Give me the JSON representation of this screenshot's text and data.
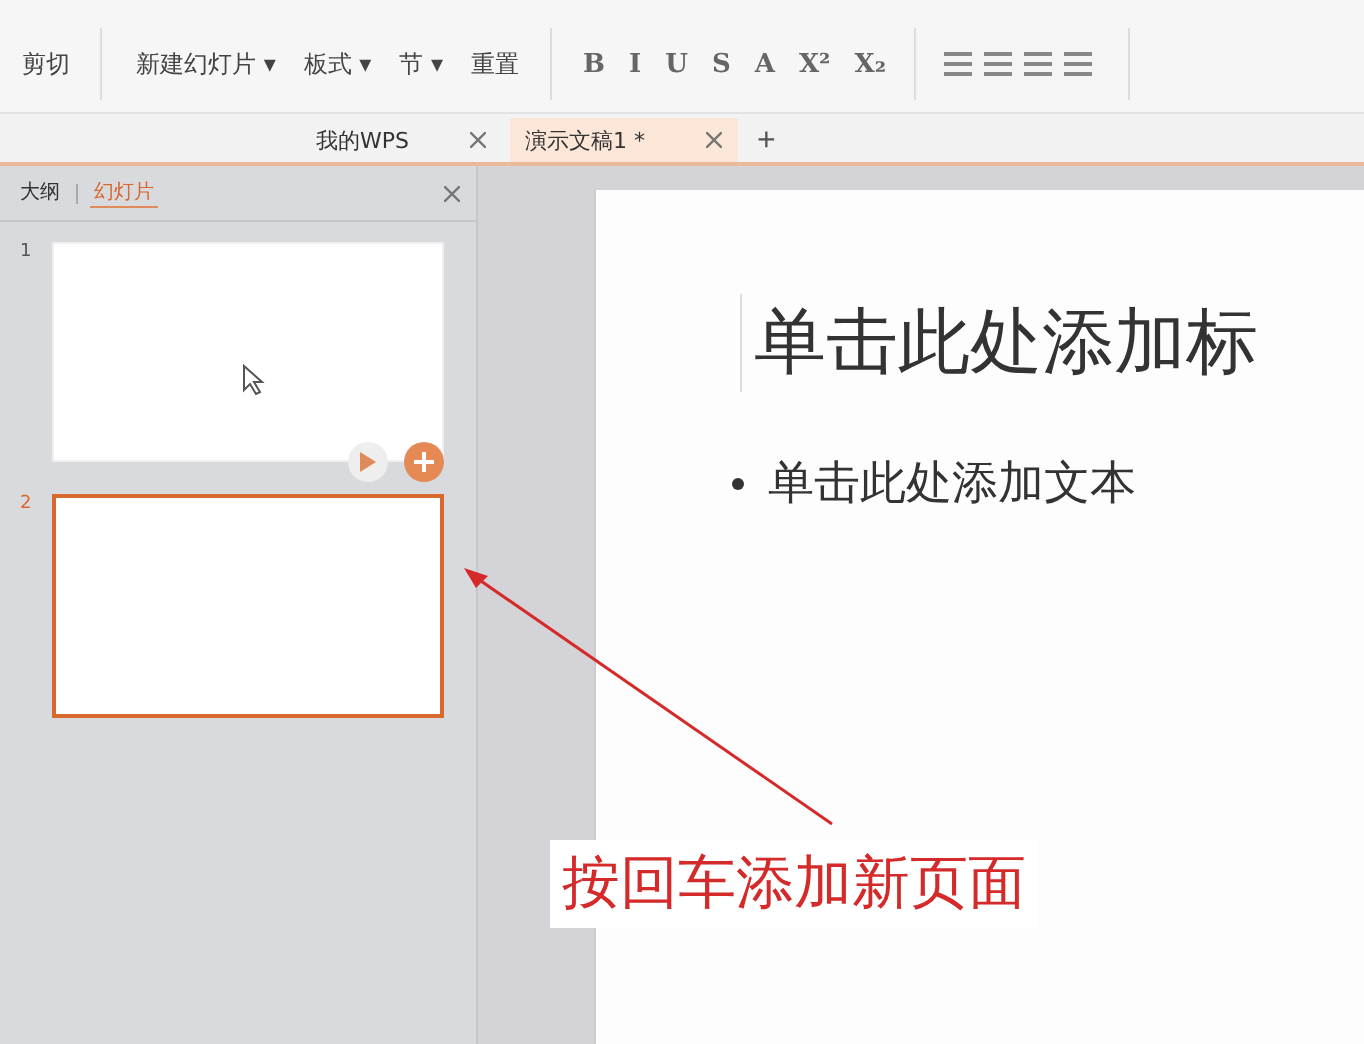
{
  "ribbon": {
    "groups": [
      {
        "kind": "clipboard",
        "items": [
          {
            "label": "剪切"
          }
        ]
      },
      {
        "kind": "slides",
        "items": [
          {
            "label": "新建幻灯片 ▾"
          },
          {
            "label": "板式 ▾"
          },
          {
            "label": "节 ▾"
          },
          {
            "label": "重置"
          }
        ]
      },
      {
        "kind": "font",
        "items": [
          {
            "label": "B"
          },
          {
            "label": "I"
          },
          {
            "label": "U"
          },
          {
            "label": "S"
          },
          {
            "label": "A"
          },
          {
            "label": "X²"
          },
          {
            "label": "X₂"
          }
        ]
      },
      {
        "kind": "paragraph"
      }
    ]
  },
  "doc_tabs": [
    {
      "label": "我的WPS",
      "selected": false
    },
    {
      "label": "演示文稿1 *",
      "selected": true
    }
  ],
  "new_tab": "+",
  "panel": {
    "tabs": [
      {
        "label": "大纲",
        "selected": false
      },
      {
        "label": "幻灯片",
        "selected": true
      }
    ],
    "slides": [
      {
        "number": "1",
        "selected": false
      },
      {
        "number": "2",
        "selected": true
      }
    ]
  },
  "slide": {
    "title": "单击此处添加标",
    "bullet": "单击此处添加文本"
  },
  "annotation": "按回车添加新页面"
}
